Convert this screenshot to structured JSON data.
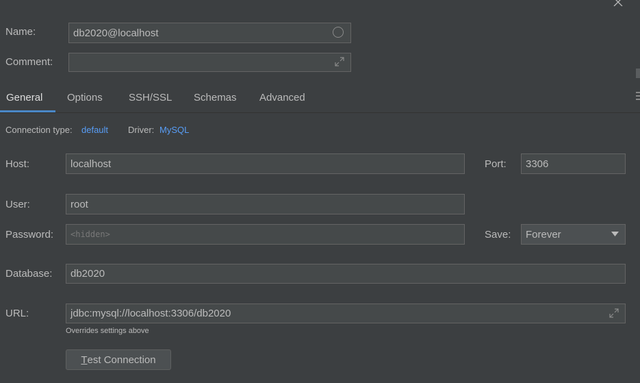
{
  "header": {
    "name_label": "Name:",
    "name_value": "db2020@localhost",
    "comment_label": "Comment:",
    "comment_value": ""
  },
  "tabs": [
    {
      "label": "General",
      "active": true
    },
    {
      "label": "Options"
    },
    {
      "label": "SSH/SSL"
    },
    {
      "label": "Schemas"
    },
    {
      "label": "Advanced"
    }
  ],
  "connection": {
    "type_label": "Connection type:",
    "type_value": "default",
    "driver_label": "Driver:",
    "driver_value": "MySQL"
  },
  "form": {
    "host_label": "Host:",
    "host_value": "localhost",
    "port_label": "Port:",
    "port_value": "3306",
    "user_label": "User:",
    "user_value": "root",
    "password_label": "Password:",
    "password_placeholder": "<hidden>",
    "save_label": "Save:",
    "save_value": "Forever",
    "database_label": "Database:",
    "database_value": "db2020",
    "url_label": "URL:",
    "url_value": "jdbc:mysql://localhost:3306/db2020",
    "url_hint": "Overrides settings above"
  },
  "actions": {
    "test_connection_mnemonic": "T",
    "test_connection_rest": "est Connection"
  },
  "colors": {
    "background": "#3c3f41",
    "accent": "#4a88c7",
    "link": "#589df6"
  }
}
